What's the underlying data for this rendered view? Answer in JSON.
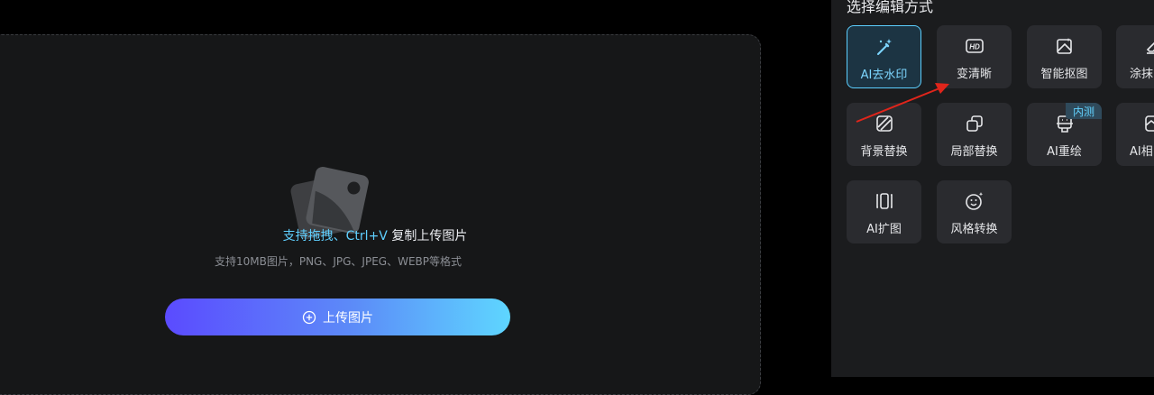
{
  "upload": {
    "hint_accent": "支持拖拽、Ctrl+V",
    "hint_rest": " 复制上传图片",
    "formats": "支持10MB图片，PNG、JPG、JPEG、WEBP等格式",
    "button_label": "上传图片",
    "icon": "image-placeholder-icon"
  },
  "panel": {
    "title": "选择编辑方式",
    "tools": [
      {
        "label": "AI去水印",
        "icon": "magic-wand-icon",
        "active": true
      },
      {
        "label": "变清晰",
        "icon": "hd-icon"
      },
      {
        "label": "智能抠图",
        "icon": "image-cutout-icon"
      },
      {
        "label": "涂抹",
        "icon": "eraser-icon"
      },
      {
        "label": "背景替换",
        "icon": "background-replace-icon"
      },
      {
        "label": "局部替换",
        "icon": "partial-replace-icon"
      },
      {
        "label": "AI重绘",
        "icon": "redraw-icon",
        "badge": "内测"
      },
      {
        "label": "AI相",
        "icon": "ai-photo-icon"
      },
      {
        "label": "AI扩图",
        "icon": "expand-icon"
      },
      {
        "label": "风格转换",
        "icon": "style-transfer-icon"
      }
    ]
  },
  "colors": {
    "accent": "#5fd0ff",
    "button_gradient_start": "#5b4bff",
    "button_gradient_end": "#5ed6ff",
    "arrow": "#e0251b"
  }
}
